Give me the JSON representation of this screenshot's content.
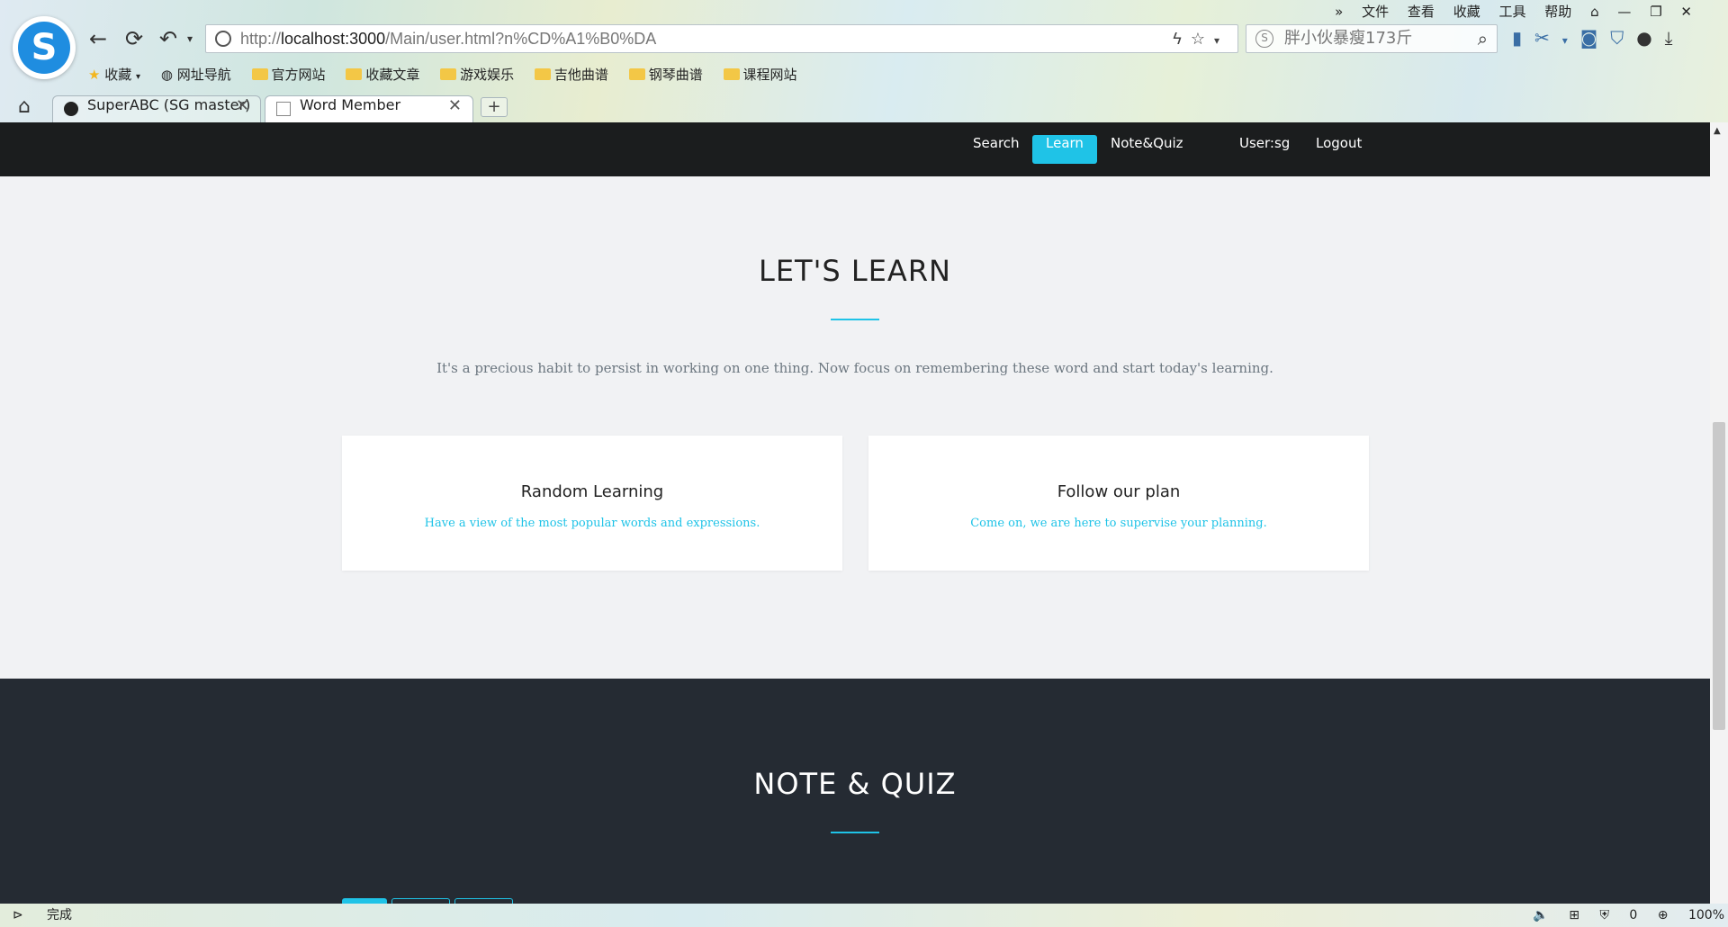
{
  "browser": {
    "menu": [
      "文件",
      "查看",
      "收藏",
      "工具",
      "帮助"
    ],
    "url_prefix": "http://",
    "url_host": "localhost:3000",
    "url_path": "/Main/user.html?n%CD%A1%B0%DA",
    "search_placeholder": "胖小伙暴瘦173斤",
    "bookmarks": [
      {
        "label": "收藏",
        "icon": "star-icon"
      },
      {
        "label": "网址导航",
        "icon": "globe-icon"
      },
      {
        "label": "官方网站",
        "icon": "folder-icon"
      },
      {
        "label": "收藏文章",
        "icon": "folder-icon"
      },
      {
        "label": "游戏娱乐",
        "icon": "folder-icon"
      },
      {
        "label": "吉他曲谱",
        "icon": "folder-icon"
      },
      {
        "label": "钢琴曲谱",
        "icon": "folder-icon"
      },
      {
        "label": "课程网站",
        "icon": "folder-icon"
      }
    ],
    "tabs": [
      {
        "label": "SuperABC (SG master)",
        "active": false
      },
      {
        "label": "Word Member",
        "active": true
      }
    ],
    "status_text": "完成",
    "status_count": "0",
    "zoom": "100%"
  },
  "site": {
    "nav": [
      {
        "label": "Search",
        "active": false
      },
      {
        "label": "Learn",
        "active": true
      },
      {
        "label": "Note&Quiz",
        "active": false
      },
      {
        "label": "User:sg",
        "active": false
      },
      {
        "label": "Logout",
        "active": false
      }
    ],
    "learn_title": "LET'S LEARN",
    "learn_subtitle": "It's a precious habit to persist in working on one thing. Now focus on remembering these word and start today's learning.",
    "cards": [
      {
        "title": "Random Learning",
        "desc": "Have a view of the most popular words and expressions."
      },
      {
        "title": "Follow our plan",
        "desc": "Come on, we are here to supervise your planning."
      }
    ],
    "quiz_title": "NOTE & QUIZ"
  },
  "colors": {
    "accent": "#1fc3e7",
    "nav_bg": "#1b1d1e",
    "dark_section": "#252b33",
    "page_bg": "#f1f2f4"
  }
}
